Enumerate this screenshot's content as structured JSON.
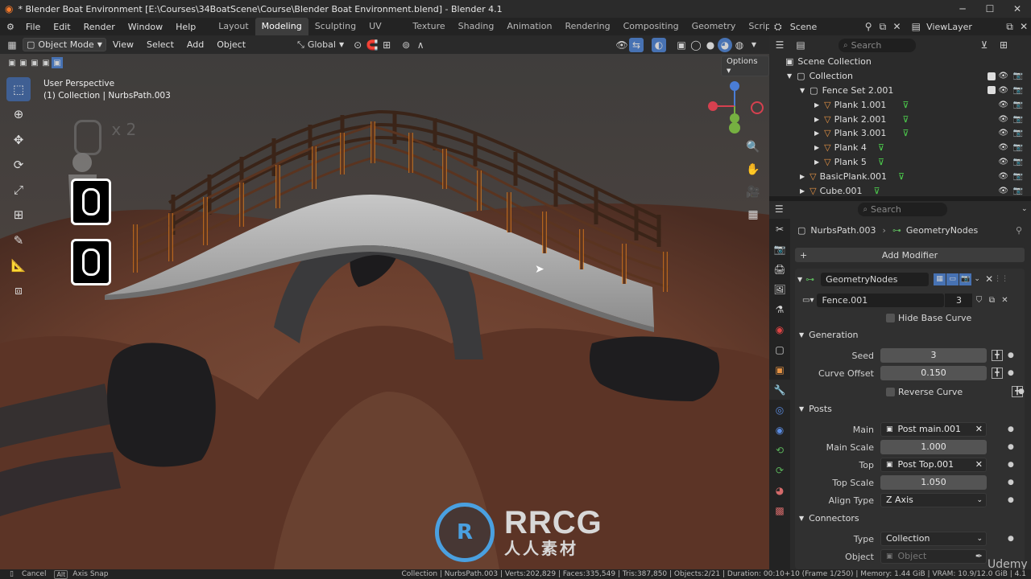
{
  "window": {
    "title": "* Blender Boat Environment [E:\\Courses\\34BoatScene\\Course\\Blender Boat Environment.blend] - Blender 4.1"
  },
  "menu": [
    "File",
    "Edit",
    "Render",
    "Window",
    "Help"
  ],
  "workspaces": [
    "Layout",
    "Modeling",
    "Sculpting",
    "UV Editing",
    "Texture Paint",
    "Shading",
    "Animation",
    "Rendering",
    "Compositing",
    "Geometry Nodes",
    "Scripting"
  ],
  "active_workspace": "Modeling",
  "scene": {
    "name": "Scene",
    "view_layer": "ViewLayer"
  },
  "viewport_header": {
    "mode": "Object Mode",
    "menus": [
      "View",
      "Select",
      "Add",
      "Object"
    ],
    "transform": "Global",
    "options": "Options"
  },
  "viewport": {
    "perspective": "User Perspective",
    "object_info": "(1) Collection | NurbsPath.003",
    "key_overlay": "x 2"
  },
  "outliner": {
    "search_placeholder": "Search",
    "items": [
      {
        "label": "Scene Collection",
        "indent": 0,
        "kind": "scene"
      },
      {
        "label": "Collection",
        "indent": 1,
        "kind": "collection",
        "check": true
      },
      {
        "label": "Fence Set 2.001",
        "indent": 2,
        "kind": "object",
        "check": true
      },
      {
        "label": "Plank 1.001",
        "indent": 3,
        "kind": "mesh",
        "filter": true
      },
      {
        "label": "Plank 2.001",
        "indent": 3,
        "kind": "mesh",
        "filter": true
      },
      {
        "label": "Plank 3.001",
        "indent": 3,
        "kind": "mesh",
        "filter": true
      },
      {
        "label": "Plank 4",
        "indent": 3,
        "kind": "mesh",
        "filter": true
      },
      {
        "label": "Plank 5",
        "indent": 3,
        "kind": "mesh",
        "filter": true
      },
      {
        "label": "BasicPlank.001",
        "indent": 2,
        "kind": "mesh",
        "filter": true
      },
      {
        "label": "Cube.001",
        "indent": 2,
        "kind": "mesh",
        "filter": true
      }
    ]
  },
  "properties": {
    "search_placeholder": "Search",
    "breadcrumb_object": "NurbsPath.003",
    "breadcrumb_modifier": "GeometryNodes",
    "add_modifier": "Add Modifier",
    "modifier_name": "GeometryNodes",
    "node_group": "Fence.001",
    "node_group_users": "3",
    "hide_base_curve": "Hide Base Curve",
    "sections": {
      "generation": "Generation",
      "posts": "Posts",
      "connectors": "Connectors"
    },
    "seed_label": "Seed",
    "seed_value": "3",
    "curve_offset_label": "Curve Offset",
    "curve_offset_value": "0.150",
    "reverse_curve": "Reverse Curve",
    "main_label": "Main",
    "main_value": "Post main.001",
    "main_scale_label": "Main Scale",
    "main_scale_value": "1.000",
    "top_label": "Top",
    "top_value": "Post Top.001",
    "top_scale_label": "Top Scale",
    "top_scale_value": "1.050",
    "align_type_label": "Align Type",
    "align_type_value": "Z Axis",
    "type_label": "Type",
    "type_value": "Collection",
    "object_label": "Object",
    "object_placeholder": "Object"
  },
  "statusbar": {
    "cancel": "Cancel",
    "alt": "Alt",
    "axis_snap": "Axis Snap",
    "info": "Collection | NurbsPath.003 | Verts:202,829 | Faces:335,549 | Tris:387,850 | Objects:2/21 | Duration: 00:10+10 (Frame 1/250) | Memory: 1.44 GiB | VRAM: 10.9/12.0 GiB | 4.1"
  },
  "watermark": {
    "brand": "RRCG",
    "sub": "人人素材",
    "corner": "Udemy"
  },
  "colors": {
    "accent": "#4772b3",
    "selection": "#ff8c1a",
    "filter_green": "#4dd04d"
  }
}
